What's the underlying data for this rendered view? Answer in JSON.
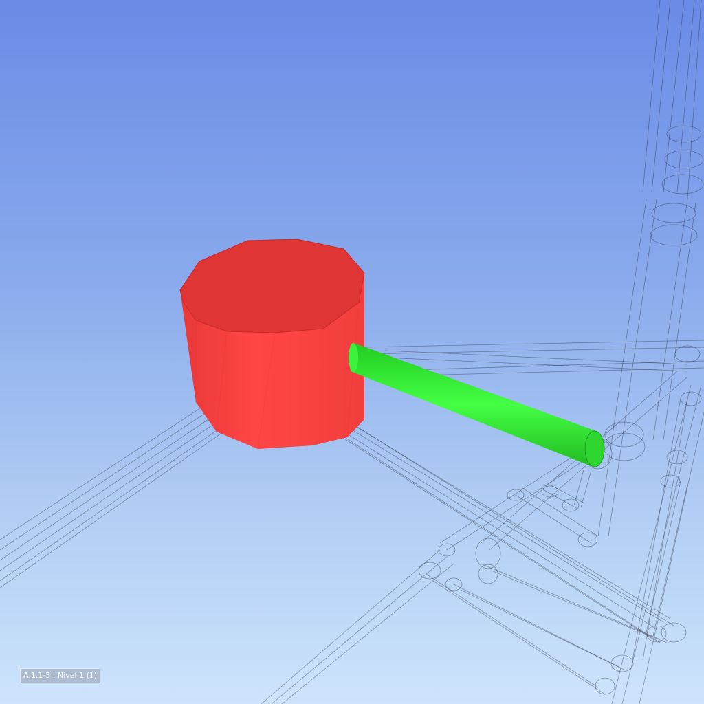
{
  "viewport": {
    "level_label": "A.1.1-5 : Nivel 1 (1)"
  },
  "colors": {
    "tank_front": "#ff4444",
    "tank_top": "#e03535",
    "connector_pipe": "#33ee33",
    "wireframe": "#2a2f3a"
  },
  "objects": [
    {
      "name": "selected-tank",
      "description": "red octagonal tank",
      "interactable": true
    },
    {
      "name": "selected-pipe",
      "description": "green connector pipe",
      "interactable": true
    },
    {
      "name": "wireframe-pipe-network",
      "description": "ghosted piping network",
      "interactable": true
    }
  ]
}
